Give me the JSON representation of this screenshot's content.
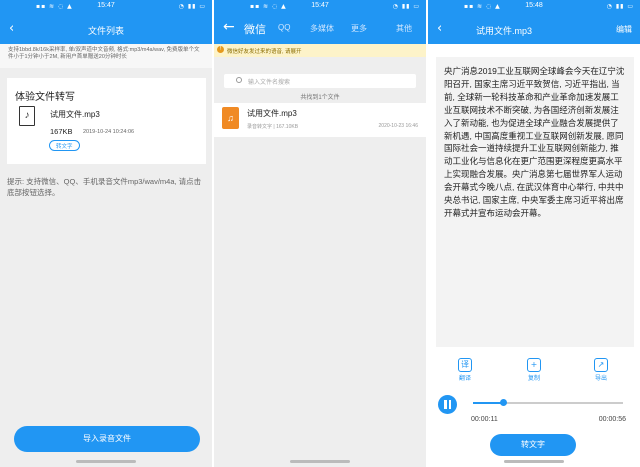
{
  "status": {
    "time_1": "15:47",
    "time_2": "15:47",
    "time_3": "15:48",
    "left_icons": "▪▪ ≋ ◌ ▲",
    "right_icons": "◔ ▮▮ ▭"
  },
  "colors": {
    "primary": "#2196F3",
    "warning_bg": "#fdf3c9",
    "file_icon": "#f08a24"
  },
  "screen1": {
    "title": "文件列表",
    "hint": "支持1bbd.8k/16k采样率, 单/双声道中文音频, 格式:mp3/m4a/wav, 免费版单个文件小于1分钟小于2M, 新用户首单赠送20分钟时长",
    "card_title": "体验文件转写",
    "file_name": "试用文件.mp3",
    "file_size": "167KB",
    "file_date": "2019-10-24 10:24:06",
    "tag": "转文字",
    "tip": "提示: 支持微信、QQ、手机录音文件mp3/wav/m4a, 请点击底部按钮选择。",
    "import_button": "导入录音文件"
  },
  "screen2": {
    "tabs": [
      "微信",
      "QQ",
      "多媒体",
      "更多",
      "其他"
    ],
    "warning": "微信好友发过来的语音, 请展开",
    "search_placeholder": "输入文件名搜索",
    "found_text": "共找到1个文件",
    "file_name": "试用文件.mp3",
    "file_meta": "录音转文字 | 167.10KB",
    "file_date": "2020-10-23 16:46"
  },
  "screen3": {
    "title": "试用文件.mp3",
    "edit": "编辑",
    "text": "央广消息2019工业互联网全球峰会今天在辽宁沈阳召开, 国家主席习近平致贺信, 习近平指出, 当前, 全球新一轮科技革命和产业革命加速发展工业互联网技术不断突破, 为各国经济创新发展注入了新动能, 也为促进全球产业融合发展提供了新机遇, 中国高度重视工业互联网创新发展, 愿同国际社会一道持续提升工业互联网创新能力, 推动工业化与信息化在更广范围更深程度更高水平上实现融合发展。央广消息第七届世界军人运动会开幕式今晚八点, 在武汉体育中心举行, 中共中央总书记, 国家主席, 中央军委主席习近平将出席开幕式并宣布运动会开幕。",
    "actions": [
      "翻译",
      "复制",
      "导出"
    ],
    "time_now": "00:00:11",
    "time_total": "00:00:56",
    "progress": 0.2,
    "convert_button": "转文字"
  }
}
